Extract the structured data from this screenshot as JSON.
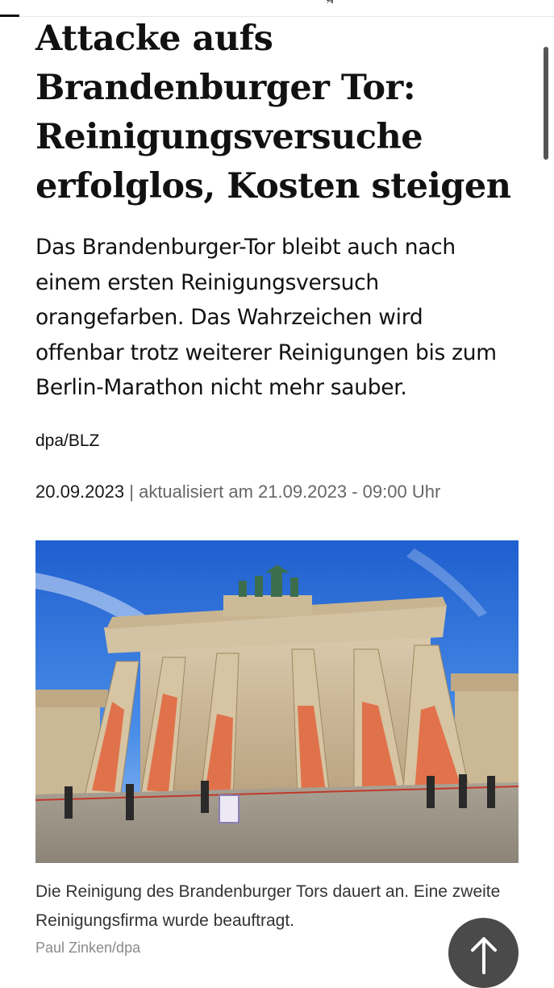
{
  "article": {
    "headline": "Attacke aufs Brandenburger Tor: Reinigungsversuche erfolglos, Kosten steigen",
    "lead": "Das Brandenburger-Tor bleibt auch nach einem ersten Reinigungsversuch orangefarben. Das Wahrzeichen wird offenbar trotz weiterer Reinigungen bis zum Berlin-Marathon nicht mehr sauber.",
    "source": "dpa/BLZ",
    "date": "20.09.2023",
    "separator": "|",
    "updated": "aktualisiert am 21.09.2023 - 09:00 Uhr"
  },
  "image": {
    "caption": "Die Reinigung des Brandenburger Tors dauert an. Eine zweite Reinigungsfirma wurde beauftragt.",
    "credit": "Paul Zinken/dpa"
  },
  "ui": {
    "scroll_top_icon": "arrow-up-icon"
  },
  "colors": {
    "text": "#111111",
    "muted": "#666666",
    "credit": "#8a8a8a",
    "fab": "#4a4a4a",
    "paint_orange": "#e4572e"
  }
}
